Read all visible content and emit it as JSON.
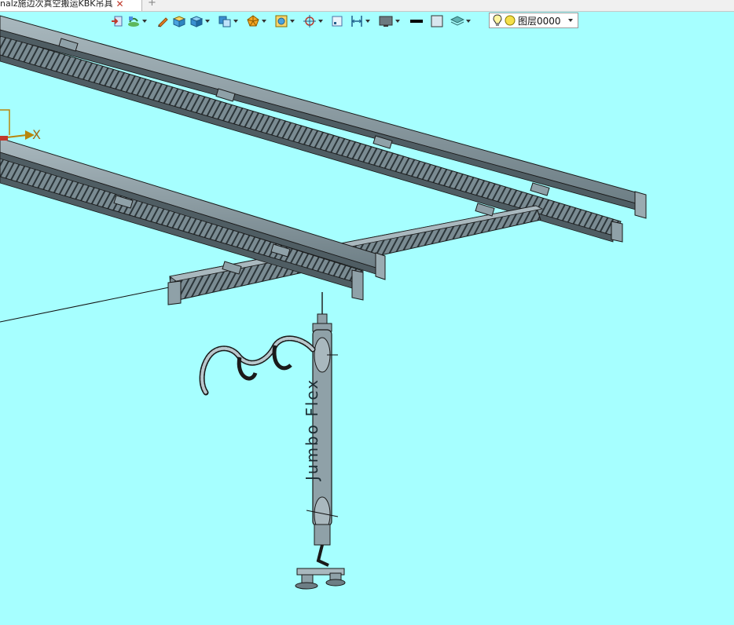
{
  "document_tab": {
    "title": "nalz施边次真空搬运KBK吊具",
    "close": "✕",
    "add": "+"
  },
  "toolbar": {
    "buttons": [
      "exit-icon",
      "sketch-icon",
      "pencil-icon",
      "box-icon",
      "cube-icon",
      "view-cube-icon",
      "polyhedron-icon",
      "frame-icon",
      "snap-target-icon",
      "snap-square-icon",
      "dimension-icon",
      "display-mode-icon",
      "line-color-icon",
      "fill-color-icon",
      "layers-icon"
    ]
  },
  "layer": {
    "name": "图层0000"
  },
  "axis": {
    "x_label": "X"
  },
  "brand": {
    "text": "Jumbo Flex"
  },
  "colors": {
    "background": "#a6ffff",
    "steel": "#8fa1a8",
    "steel_dark": "#5c6c72",
    "outline": "#1a1a1a"
  }
}
